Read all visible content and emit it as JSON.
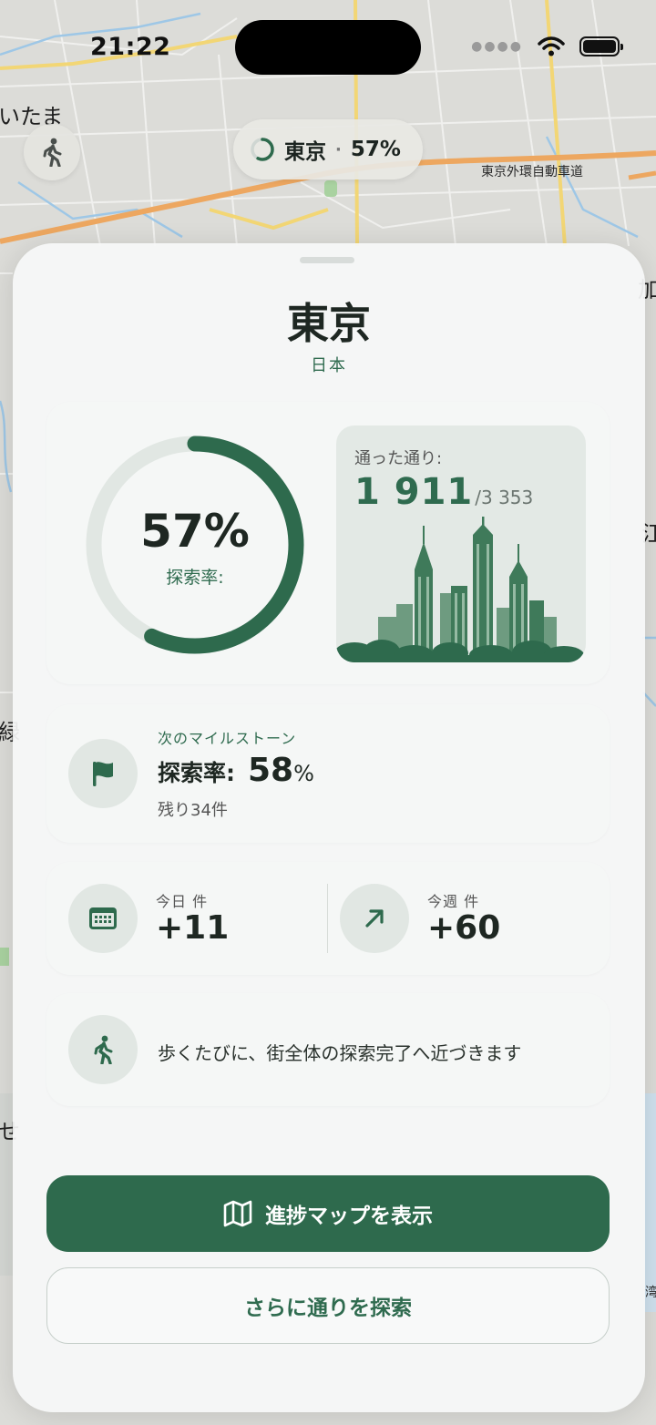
{
  "status_bar": {
    "time": "21:22"
  },
  "map": {
    "labels": {
      "saitama": "いたま",
      "expressway": "東京外環自動車道",
      "edge_right_top": "加",
      "edge_right_mid": "江",
      "edge_left_mid": "緑",
      "edge_left_low": "せ",
      "edge_right_low": "湾"
    }
  },
  "top_pill": {
    "city": "東京",
    "separator": "·",
    "percent": "57%"
  },
  "sheet": {
    "title": "東京",
    "country": "日本",
    "progress": {
      "percent_label": "57%",
      "label": "探索率:",
      "fraction": 0.57
    },
    "streets": {
      "title": "通った通り:",
      "walked": "1 911",
      "total": "/3 353"
    },
    "milestone": {
      "subtitle": "次のマイルストーン",
      "label": "探索率:",
      "value": "58",
      "unit": "%",
      "remaining": "残り34件"
    },
    "stats": {
      "today": {
        "label": "今日 件",
        "value": "+11"
      },
      "week": {
        "label": "今週 件",
        "value": "+60"
      }
    },
    "tip": {
      "text": "歩くたびに、街全体の探索完了へ近づきます"
    },
    "buttons": {
      "primary": "進捗マップを表示",
      "secondary": "さらに通りを探索"
    }
  },
  "colors": {
    "accent": "#2e6a4d",
    "ring_track": "#e1e7e3"
  }
}
